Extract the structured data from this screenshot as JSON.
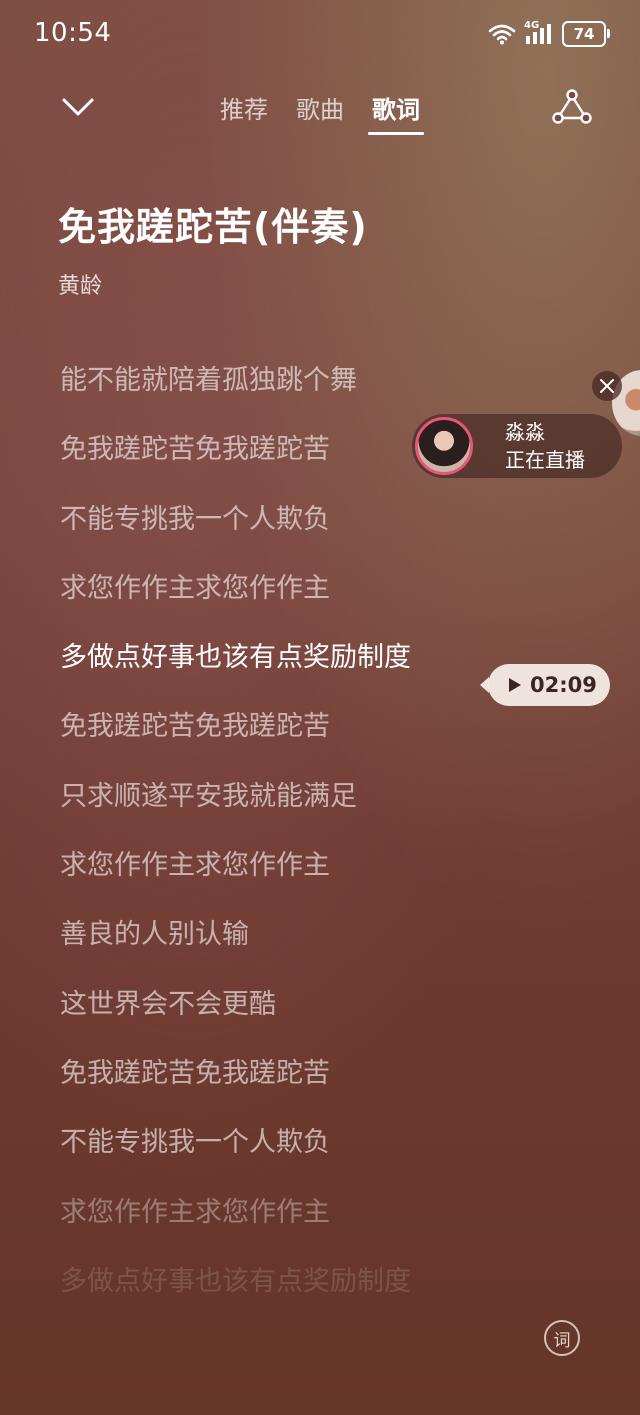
{
  "status_bar": {
    "time": "10:54",
    "network": "4G",
    "battery": "74"
  },
  "tabs": [
    {
      "label": "推荐",
      "active": false
    },
    {
      "label": "歌曲",
      "active": false
    },
    {
      "label": "歌词",
      "active": true
    }
  ],
  "song": {
    "title": "免我蹉跎苦(伴奏)",
    "artist": "黄龄"
  },
  "lyrics": [
    "能不能就陪着孤独跳个舞",
    "免我蹉跎苦免我蹉跎苦",
    "不能专挑我一个人欺负",
    "求您作作主求您作作主",
    "多做点好事也该有点奖励制度",
    "免我蹉跎苦免我蹉跎苦",
    "只求顺遂平安我就能满足",
    "求您作作主求您作作主",
    "善良的人别认输",
    "这世界会不会更酷",
    "免我蹉跎苦免我蹉跎苦",
    "不能专挑我一个人欺负",
    "求您作作主求您作作主",
    "多做点好事也该有点奖励制度"
  ],
  "current_lyric_index": 4,
  "live": {
    "name": "淼淼",
    "status": "正在直播"
  },
  "seek": {
    "time": "02:09"
  },
  "lyric_mode_label": "词",
  "colors": {
    "accent_live_ring": "#e8567a",
    "background": "#78453d"
  }
}
